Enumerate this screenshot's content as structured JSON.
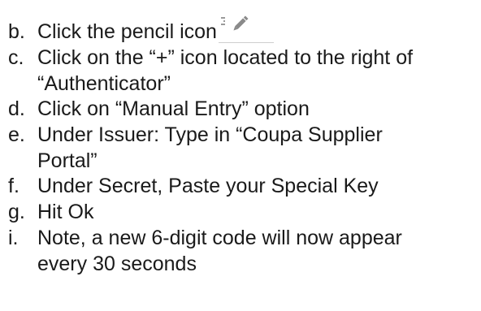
{
  "steps": [
    {
      "marker": "b.",
      "text": "Click the pencil icon"
    },
    {
      "marker": "c.",
      "text": "Click on the “+” icon located to the right of\n“Authenticator”"
    },
    {
      "marker": "d.",
      "text": "Click on “Manual Entry” option"
    },
    {
      "marker": "e.",
      "text": "Under Issuer: Type in “Coupa Supplier\nPortal”"
    },
    {
      "marker": "f.",
      "text": "Under Secret, Paste your Special Key"
    },
    {
      "marker": "g.",
      "text": "Hit Ok"
    },
    {
      "marker": "i.",
      "text": "Note, a new 6-digit code will now appear\nevery 30 seconds"
    }
  ],
  "inline_icon": {
    "name": "pencil-icon",
    "color": "#8a8a8a",
    "underline_color": "#cfcfcf"
  }
}
